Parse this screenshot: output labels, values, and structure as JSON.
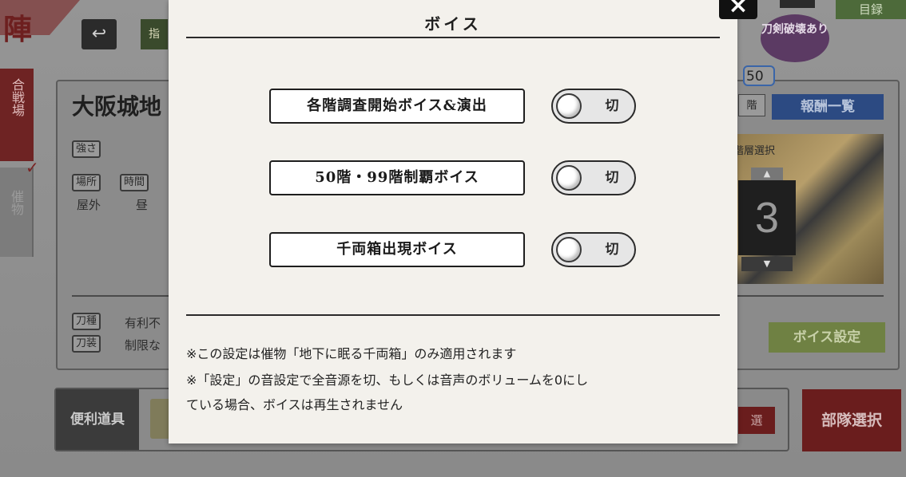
{
  "background": {
    "title_kanji": "陣",
    "top_tab_label": "指",
    "side_tabs": [
      {
        "label": "合戦場"
      },
      {
        "label": "催物"
      }
    ],
    "stage_name": "大阪城地",
    "tags": {
      "strength": "強さ",
      "location": "場所",
      "time": "時間",
      "sword_type": "刀種",
      "sword_equip": "刀装"
    },
    "location_value": "屋外",
    "time_value": "昼",
    "sword_type_value": "有利不",
    "sword_equip_value": "制限な",
    "destroy_badge": "刀剣破壊あり",
    "top_right_button": "目録",
    "floor_count": "50",
    "floor_label": "階",
    "reward_button": "報酬一覧",
    "floor_select_label": "階層選択",
    "current_floor": "3",
    "voice_settings_button": "ボイス設定",
    "tools_label": "便利道具",
    "unit_select_button": "部隊選択",
    "small_button": "選"
  },
  "modal": {
    "title": "ボイス",
    "options": [
      {
        "label": "各階調査開始ボイス&演出",
        "state": "切"
      },
      {
        "label": "50階・99階制覇ボイス",
        "state": "切"
      },
      {
        "label": "千両箱出現ボイス",
        "state": "切"
      }
    ],
    "notes": [
      "※この設定は催物「地下に眠る千両箱」のみ適用されます",
      "※「設定」の音設定で全音源を切、もしくは音声のボリュームを0にし",
      "ている場合、ボイスは再生されません"
    ],
    "close_icon": "×"
  }
}
